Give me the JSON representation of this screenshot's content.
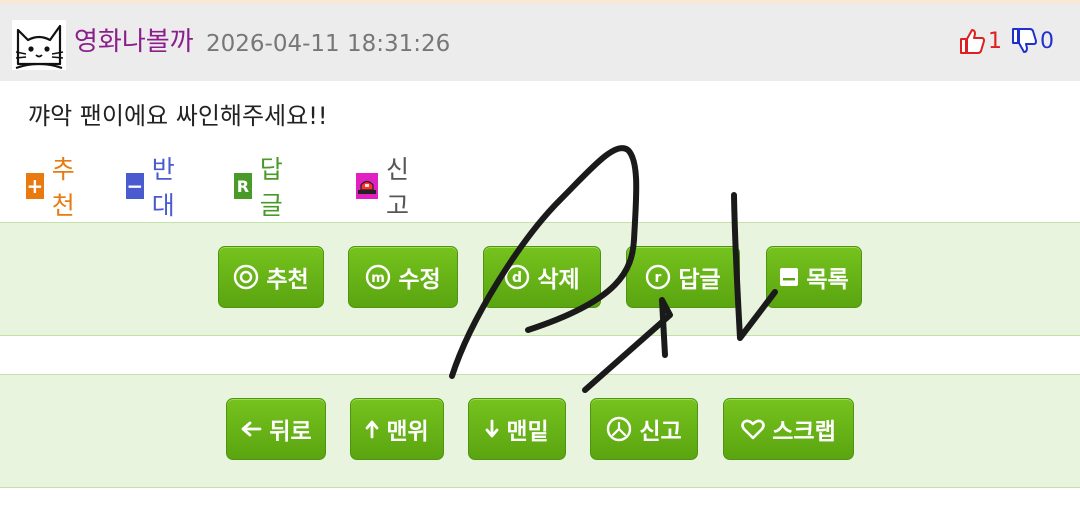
{
  "post": {
    "author": "영화나볼까",
    "datetime": "2026-04-11 18:31:26",
    "upvotes": "1",
    "downvotes": "0",
    "comment": "꺄악 팬이에요 싸인해주세요!!"
  },
  "actions": {
    "recommend": "추천",
    "oppose": "반대",
    "reply": "답글",
    "report": "신고",
    "recommend_icon_text": "+",
    "oppose_icon_text": "−",
    "reply_icon_text": "R"
  },
  "buttons_row1": {
    "recommend": "추천",
    "edit": "수정",
    "delete": "삭제",
    "reply": "답글",
    "list": "목록"
  },
  "buttons_row2": {
    "back": "뒤로",
    "top": "맨위",
    "bottom": "맨밑",
    "report": "신고",
    "scrap": "스크랩"
  },
  "colors": {
    "author": "#8b1e8c",
    "recommend": "#e87a10",
    "oppose": "#4a5bd0",
    "reply": "#4a9a2a",
    "report_icon": "#e020c0",
    "button_green": "#62ad15",
    "band_bg": "#e8f4dd"
  },
  "icons": {
    "avatar": "cat-face-icon",
    "upvote": "thumbs-up-icon",
    "downvote": "thumbs-down-icon",
    "report": "siren-icon"
  }
}
